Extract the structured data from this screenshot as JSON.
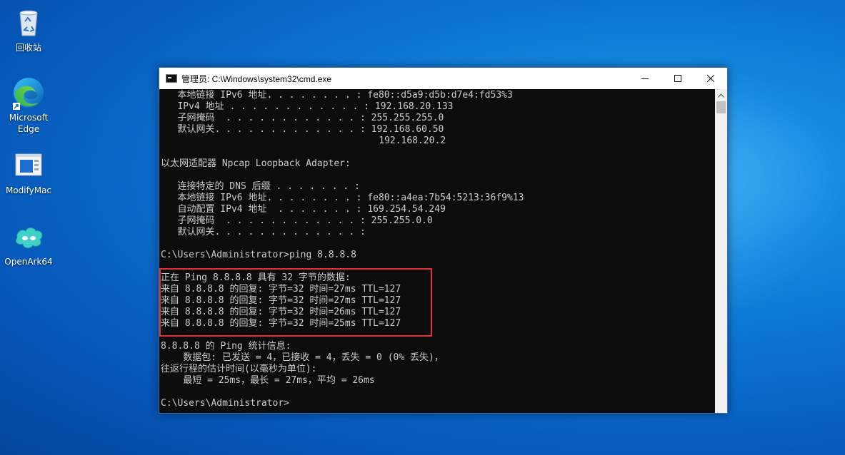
{
  "desktop": {
    "icons": [
      {
        "label": "回收站",
        "icon": "recycle-bin-icon"
      },
      {
        "label": "Microsoft\nEdge",
        "icon": "edge-icon"
      },
      {
        "label": "ModifyMac",
        "icon": "modifymac-icon"
      },
      {
        "label": "OpenArk64",
        "icon": "openark-icon"
      }
    ]
  },
  "window": {
    "title": "管理员: C:\\Windows\\system32\\cmd.exe",
    "minimize_icon": "minimize-icon",
    "maximize_icon": "maximize-icon",
    "close_icon": "close-icon",
    "highlight_color": "#e03232"
  },
  "console": {
    "lines": [
      "   本地链接 IPv6 地址. . . . . . . . : fe80::d5a9:d5b:d7e4:fd53%3",
      "   IPv4 地址 . . . . . . . . . . . . : 192.168.20.133",
      "   子网掩码  . . . . . . . . . . . . : 255.255.255.0",
      "   默认网关. . . . . . . . . . . . . : 192.168.60.50",
      "                                       192.168.20.2",
      "",
      "以太网适配器 Npcap Loopback Adapter:",
      "",
      "   连接特定的 DNS 后缀 . . . . . . . :",
      "   本地链接 IPv6 地址. . . . . . . . : fe80::a4ea:7b54:5213:36f9%13",
      "   自动配置 IPv4 地址  . . . . . . . : 169.254.54.249",
      "   子网掩码  . . . . . . . . . . . . : 255.255.0.0",
      "   默认网关. . . . . . . . . . . . . :",
      "",
      "C:\\Users\\Administrator>ping 8.8.8.8",
      "",
      "正在 Ping 8.8.8.8 具有 32 字节的数据:",
      "来自 8.8.8.8 的回复: 字节=32 时间=27ms TTL=127",
      "来自 8.8.8.8 的回复: 字节=32 时间=27ms TTL=127",
      "来自 8.8.8.8 的回复: 字节=32 时间=26ms TTL=127",
      "来自 8.8.8.8 的回复: 字节=32 时间=25ms TTL=127",
      "",
      "8.8.8.8 的 Ping 统计信息:",
      "    数据包: 已发送 = 4，已接收 = 4，丢失 = 0 (0% 丢失)，",
      "往返行程的估计时间(以毫秒为单位):",
      "    最短 = 25ms，最长 = 27ms，平均 = 26ms",
      "",
      "C:\\Users\\Administrator>"
    ]
  }
}
